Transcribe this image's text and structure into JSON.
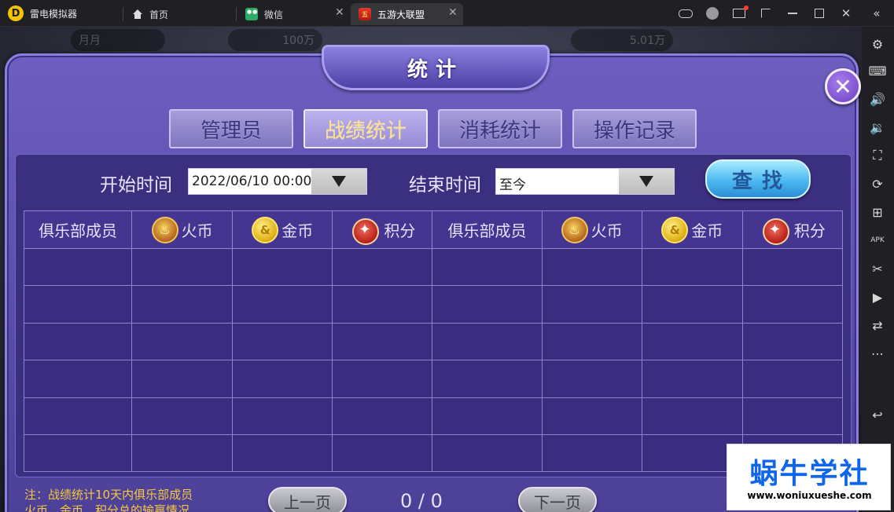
{
  "titlebar": {
    "app_name": "雷电模拟器",
    "tabs": [
      {
        "label": "首页",
        "icon": "home-icon"
      },
      {
        "label": "微信",
        "icon": "wechat-icon"
      },
      {
        "label": "五游大联盟",
        "icon": "game-icon",
        "active": true
      }
    ],
    "window_controls": [
      "gamepad-icon",
      "avatar-icon",
      "mail-icon",
      "restore-icon",
      "minimize-icon",
      "maximize-icon",
      "close-icon",
      "collapse-icon"
    ]
  },
  "sidebar": {
    "items": [
      "settings-icon",
      "keyboard-icon",
      "volume-up-icon",
      "volume-down-icon",
      "screenshot-icon",
      "rotate-icon",
      "add-app-icon",
      "apk-icon",
      "scissors-icon",
      "video-icon",
      "sync-icon",
      "more-icon",
      "back-icon"
    ]
  },
  "background_hud": {
    "name": "月月",
    "coins_left": "100万",
    "coins_right": "5.01万"
  },
  "dialog": {
    "title": "统计",
    "close_label": "✕",
    "tabs": [
      {
        "label": "管理员",
        "active": false
      },
      {
        "label": "战绩统计",
        "active": true
      },
      {
        "label": "消耗统计",
        "active": false
      },
      {
        "label": "操作记录",
        "active": false
      }
    ],
    "filter": {
      "start_label": "开始时间",
      "start_value": "2022/06/10 00:00",
      "end_label": "结束时间",
      "end_value": "至今",
      "search_label": "查找"
    },
    "table": {
      "headers": [
        {
          "label": "俱乐部成员",
          "icon": null
        },
        {
          "label": "火币",
          "icon": "fire-coin-icon"
        },
        {
          "label": "金币",
          "icon": "gold-coin-icon"
        },
        {
          "label": "积分",
          "icon": "points-icon"
        },
        {
          "label": "俱乐部成员",
          "icon": null
        },
        {
          "label": "火币",
          "icon": "fire-coin-icon"
        },
        {
          "label": "金币",
          "icon": "gold-coin-icon"
        },
        {
          "label": "积分",
          "icon": "points-icon"
        }
      ],
      "row_count": 6
    },
    "note_line1": "注：战绩统计10天内俱乐部成员",
    "note_line2": "火币、金币、积分总的输赢情况",
    "prev_label": "上一页",
    "next_label": "下一页",
    "page_indicator": "0 / 0"
  },
  "watermark": {
    "title": "蜗牛学社",
    "url": "www.woniuxueshe.com"
  },
  "colors": {
    "dialog_purple": "#5b4dae",
    "active_tab_text": "#ffe38a",
    "note_yellow": "#f7c93d",
    "search_blue": "#4bb9f0"
  }
}
